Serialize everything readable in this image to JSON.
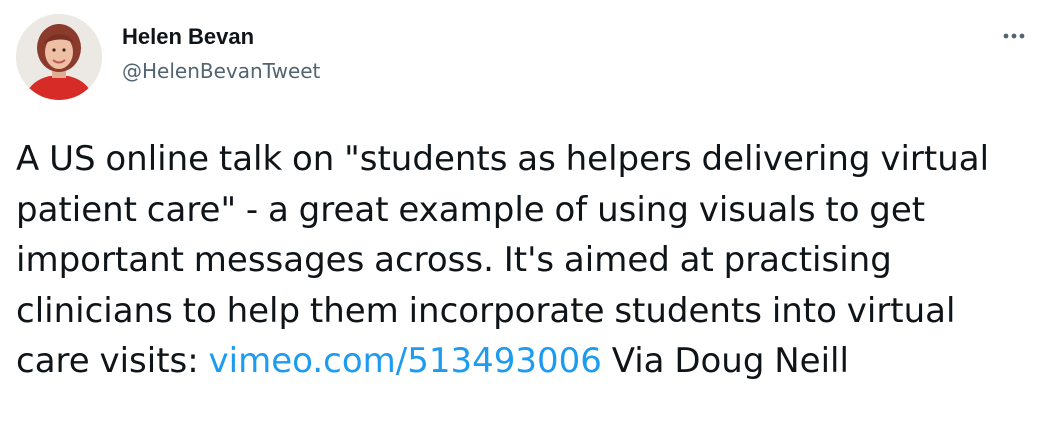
{
  "author": {
    "display_name": "Helen Bevan",
    "handle": "@HelenBevanTweet"
  },
  "icons": {
    "avatar": "profile-photo",
    "more": "more-options-icon"
  },
  "tweet": {
    "text_before_link": "A US online talk on \"students as helpers delivering virtual patient care\" - a great example of using visuals to get important messages across. It's aimed at practising clinicians to help them incorporate students into virtual care visits: ",
    "link_text": "vimeo.com/513493006",
    "text_after_link": " Via Doug Neill"
  },
  "colors": {
    "text": "#0f1419",
    "secondary": "#536471",
    "link": "#1d9bf0"
  }
}
